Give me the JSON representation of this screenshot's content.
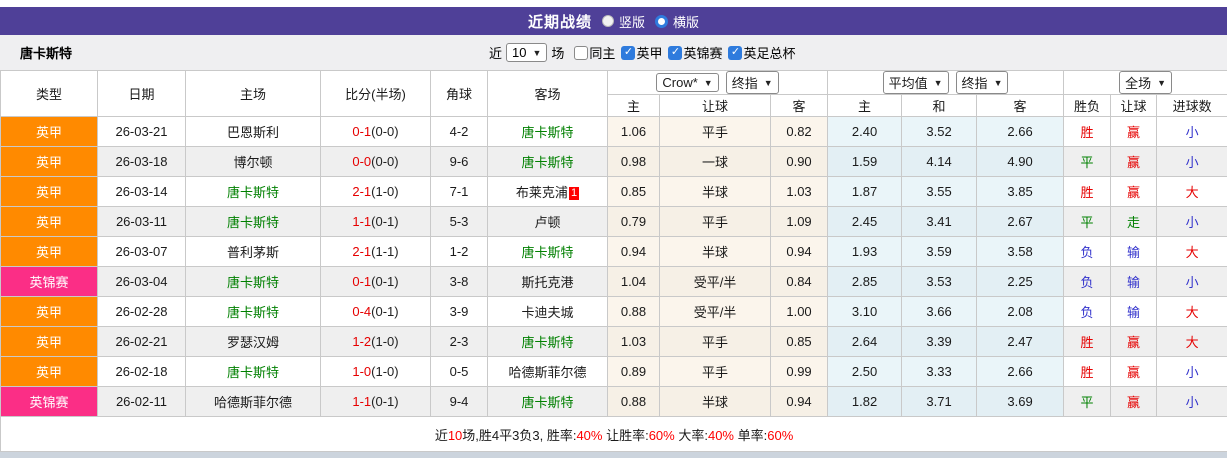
{
  "title_bar": {
    "title": "近期战绩",
    "radios": [
      {
        "label": "竖版",
        "checked": false
      },
      {
        "label": "横版",
        "checked": true
      }
    ]
  },
  "toolbar": {
    "team": "唐卡斯特",
    "recent_label": "近",
    "recent_value": "10",
    "games_label": "场",
    "checkboxes": [
      {
        "label": "同主",
        "checked": false
      },
      {
        "label": "英甲",
        "checked": true
      },
      {
        "label": "英锦赛",
        "checked": true
      },
      {
        "label": "英足总杯",
        "checked": true
      }
    ]
  },
  "header": {
    "columns": [
      "类型",
      "日期",
      "主场",
      "比分(半场)",
      "角球",
      "客场"
    ],
    "odds_group": {
      "select1": "Crow*",
      "select2": "终指",
      "cols": [
        "主",
        "让球",
        "客"
      ]
    },
    "avg_group": {
      "select1": "平均值",
      "select2": "终指",
      "cols": [
        "主",
        "和",
        "客"
      ]
    },
    "result_group": {
      "select": "全场",
      "cols": [
        "胜负",
        "让球",
        "进球数"
      ]
    }
  },
  "colors": {
    "header_purple": "#4f4098",
    "league_one_badge": "#ff8a00",
    "trophy_badge": "#fb2e86",
    "team_green": "#008000",
    "score_red": "#e60000",
    "loss_blue": "#3232cc",
    "odds_cream_bg": "#fbf5ec",
    "avg_blue_bg": "#eaf5f9",
    "alt_row_bg": "#efefef"
  },
  "rows": [
    {
      "type": "英甲",
      "type_key": "league",
      "date": "26-03-21",
      "home": "巴恩斯利",
      "home_green": false,
      "score": "0-1",
      "half": "(0-0)",
      "corner": "4-2",
      "away": "唐卡斯特",
      "away_green": true,
      "away_badge": "",
      "odds_home": "1.06",
      "handicap": "平手",
      "odds_away": "0.82",
      "avg_home": "2.40",
      "avg_draw": "3.52",
      "avg_away": "2.66",
      "outcome": "胜",
      "outcome_c": "red",
      "handicap_res": "赢",
      "handicap_res_c": "red",
      "goals": "小",
      "goals_c": "blue"
    },
    {
      "type": "英甲",
      "type_key": "league",
      "date": "26-03-18",
      "home": "博尔顿",
      "home_green": false,
      "score": "0-0",
      "half": "(0-0)",
      "corner": "9-6",
      "away": "唐卡斯特",
      "away_green": true,
      "away_badge": "",
      "odds_home": "0.98",
      "handicap": "一球",
      "odds_away": "0.90",
      "avg_home": "1.59",
      "avg_draw": "4.14",
      "avg_away": "4.90",
      "outcome": "平",
      "outcome_c": "green-res",
      "handicap_res": "赢",
      "handicap_res_c": "red",
      "goals": "小",
      "goals_c": "blue"
    },
    {
      "type": "英甲",
      "type_key": "league",
      "date": "26-03-14",
      "home": "唐卡斯特",
      "home_green": true,
      "score": "2-1",
      "half": "(1-0)",
      "corner": "7-1",
      "away": "布莱克浦",
      "away_green": false,
      "away_badge": "1",
      "odds_home": "0.85",
      "handicap": "半球",
      "odds_away": "1.03",
      "avg_home": "1.87",
      "avg_draw": "3.55",
      "avg_away": "3.85",
      "outcome": "胜",
      "outcome_c": "red",
      "handicap_res": "赢",
      "handicap_res_c": "red",
      "goals": "大",
      "goals_c": "red"
    },
    {
      "type": "英甲",
      "type_key": "league",
      "date": "26-03-11",
      "home": "唐卡斯特",
      "home_green": true,
      "score": "1-1",
      "half": "(0-1)",
      "corner": "5-3",
      "away": "卢顿",
      "away_green": false,
      "away_badge": "",
      "odds_home": "0.79",
      "handicap": "平手",
      "odds_away": "1.09",
      "avg_home": "2.45",
      "avg_draw": "3.41",
      "avg_away": "2.67",
      "outcome": "平",
      "outcome_c": "green-res",
      "handicap_res": "走",
      "handicap_res_c": "green-res",
      "goals": "小",
      "goals_c": "blue"
    },
    {
      "type": "英甲",
      "type_key": "league",
      "date": "26-03-07",
      "home": "普利茅斯",
      "home_green": false,
      "score": "2-1",
      "half": "(1-1)",
      "corner": "1-2",
      "away": "唐卡斯特",
      "away_green": true,
      "away_badge": "",
      "odds_home": "0.94",
      "handicap": "半球",
      "odds_away": "0.94",
      "avg_home": "1.93",
      "avg_draw": "3.59",
      "avg_away": "3.58",
      "outcome": "负",
      "outcome_c": "blue",
      "handicap_res": "输",
      "handicap_res_c": "blue",
      "goals": "大",
      "goals_c": "red"
    },
    {
      "type": "英锦赛",
      "type_key": "trophy",
      "date": "26-03-04",
      "home": "唐卡斯特",
      "home_green": true,
      "score": "0-1",
      "half": "(0-1)",
      "corner": "3-8",
      "away": "斯托克港",
      "away_green": false,
      "away_badge": "",
      "odds_home": "1.04",
      "handicap": "受平/半",
      "odds_away": "0.84",
      "avg_home": "2.85",
      "avg_draw": "3.53",
      "avg_away": "2.25",
      "outcome": "负",
      "outcome_c": "blue",
      "handicap_res": "输",
      "handicap_res_c": "blue",
      "goals": "小",
      "goals_c": "blue"
    },
    {
      "type": "英甲",
      "type_key": "league",
      "date": "26-02-28",
      "home": "唐卡斯特",
      "home_green": true,
      "score": "0-4",
      "half": "(0-1)",
      "corner": "3-9",
      "away": "卡迪夫城",
      "away_green": false,
      "away_badge": "",
      "odds_home": "0.88",
      "handicap": "受平/半",
      "odds_away": "1.00",
      "avg_home": "3.10",
      "avg_draw": "3.66",
      "avg_away": "2.08",
      "outcome": "负",
      "outcome_c": "blue",
      "handicap_res": "输",
      "handicap_res_c": "blue",
      "goals": "大",
      "goals_c": "red"
    },
    {
      "type": "英甲",
      "type_key": "league",
      "date": "26-02-21",
      "home": "罗瑟汉姆",
      "home_green": false,
      "score": "1-2",
      "half": "(1-0)",
      "corner": "2-3",
      "away": "唐卡斯特",
      "away_green": true,
      "away_badge": "",
      "odds_home": "1.03",
      "handicap": "平手",
      "odds_away": "0.85",
      "avg_home": "2.64",
      "avg_draw": "3.39",
      "avg_away": "2.47",
      "outcome": "胜",
      "outcome_c": "red",
      "handicap_res": "赢",
      "handicap_res_c": "red",
      "goals": "大",
      "goals_c": "red"
    },
    {
      "type": "英甲",
      "type_key": "league",
      "date": "26-02-18",
      "home": "唐卡斯特",
      "home_green": true,
      "score": "1-0",
      "half": "(1-0)",
      "corner": "0-5",
      "away": "哈德斯菲尔德",
      "away_green": false,
      "away_badge": "",
      "odds_home": "0.89",
      "handicap": "平手",
      "odds_away": "0.99",
      "avg_home": "2.50",
      "avg_draw": "3.33",
      "avg_away": "2.66",
      "outcome": "胜",
      "outcome_c": "red",
      "handicap_res": "赢",
      "handicap_res_c": "red",
      "goals": "小",
      "goals_c": "blue"
    },
    {
      "type": "英锦赛",
      "type_key": "trophy",
      "date": "26-02-11",
      "home": "哈德斯菲尔德",
      "home_green": false,
      "score": "1-1",
      "half": "(0-1)",
      "corner": "9-4",
      "away": "唐卡斯特",
      "away_green": true,
      "away_badge": "",
      "odds_home": "0.88",
      "handicap": "半球",
      "odds_away": "0.94",
      "avg_home": "1.82",
      "avg_draw": "3.71",
      "avg_away": "3.69",
      "outcome": "平",
      "outcome_c": "green-res",
      "handicap_res": "赢",
      "handicap_res_c": "red",
      "goals": "小",
      "goals_c": "blue"
    }
  ],
  "footer_segments": [
    {
      "text": "近",
      "c": "f-black"
    },
    {
      "text": "10",
      "c": "f-red"
    },
    {
      "text": "场,胜4平3负3, 胜率:",
      "c": "f-black"
    },
    {
      "text": "40%",
      "c": "f-red"
    },
    {
      "text": " 让胜率:",
      "c": "f-black"
    },
    {
      "text": "60%",
      "c": "f-red"
    },
    {
      "text": " 大率:",
      "c": "f-black"
    },
    {
      "text": "40%",
      "c": "f-red"
    },
    {
      "text": " 单率:",
      "c": "f-black"
    },
    {
      "text": "60%",
      "c": "f-red"
    }
  ]
}
